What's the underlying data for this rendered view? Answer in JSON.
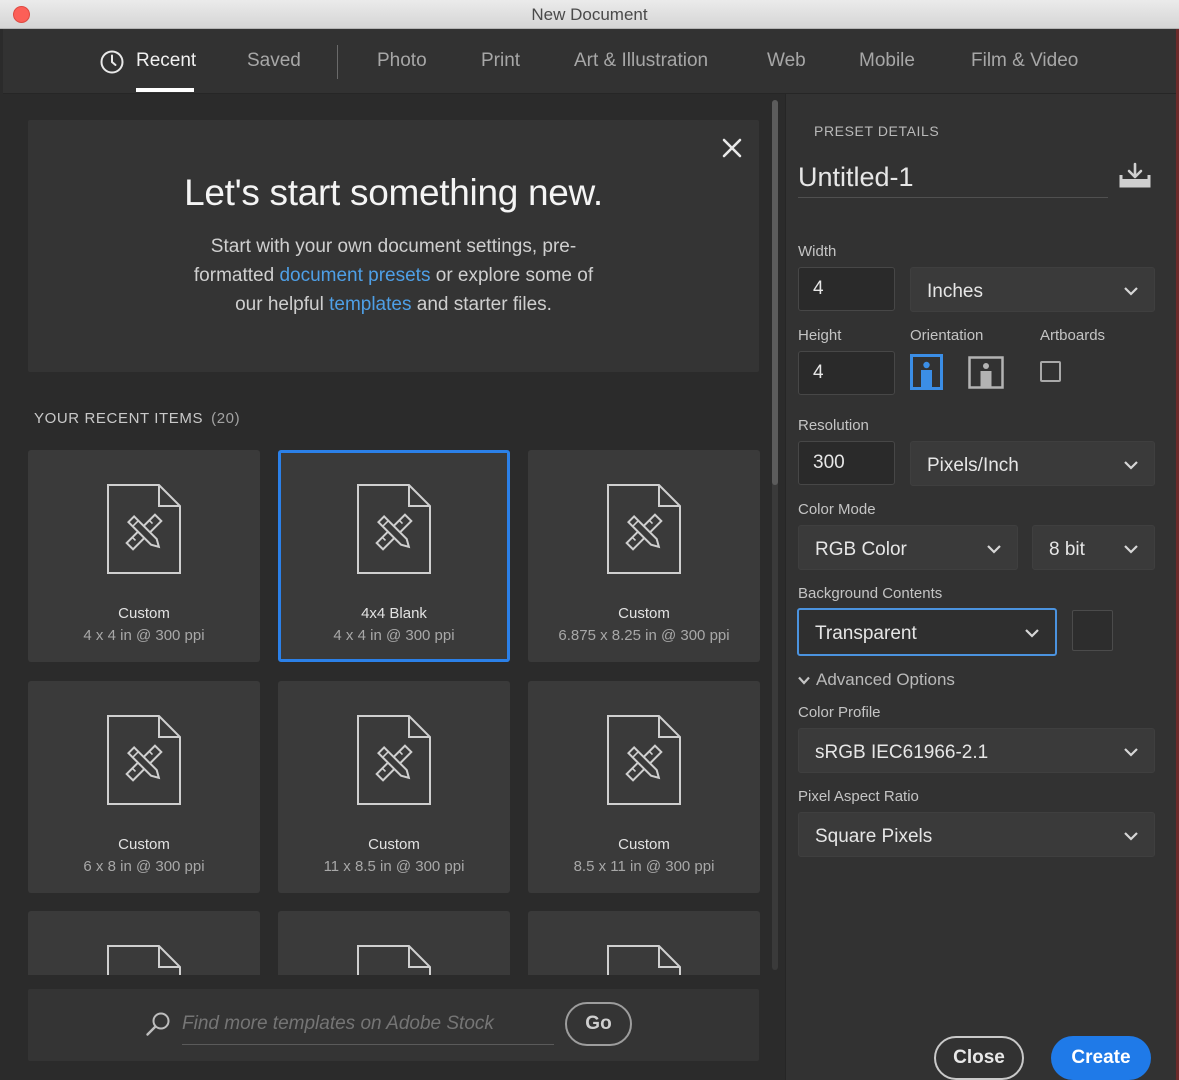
{
  "window": {
    "title": "New Document"
  },
  "tabs": [
    {
      "label": "Recent",
      "active": true
    },
    {
      "label": "Saved"
    },
    {
      "label": "Photo"
    },
    {
      "label": "Print"
    },
    {
      "label": "Art & Illustration"
    },
    {
      "label": "Web"
    },
    {
      "label": "Mobile"
    },
    {
      "label": "Film & Video"
    }
  ],
  "welcome": {
    "heading": "Let's start something new.",
    "line1": "Start with your own document settings, pre-",
    "line2_a": "formatted ",
    "line2_link": "document presets",
    "line2_b": " or explore some of",
    "line3_a": "our helpful ",
    "line3_link": "templates",
    "line3_b": " and starter files."
  },
  "recent": {
    "label": "YOUR RECENT ITEMS",
    "count": "(20)",
    "items": [
      {
        "name": "Custom",
        "size": "4 x 4 in @ 300 ppi"
      },
      {
        "name": "4x4 Blank",
        "size": "4 x 4 in @ 300 ppi",
        "selected": true
      },
      {
        "name": "Custom",
        "size": "6.875 x 8.25 in @ 300 ppi"
      },
      {
        "name": "Custom",
        "size": "6 x 8 in @ 300 ppi"
      },
      {
        "name": "Custom",
        "size": "11 x 8.5 in @ 300 ppi"
      },
      {
        "name": "Custom",
        "size": "8.5 x 11 in @ 300 ppi"
      }
    ]
  },
  "stock": {
    "placeholder": "Find more templates on Adobe Stock",
    "go_label": "Go"
  },
  "preset": {
    "section_title": "PRESET DETAILS",
    "doc_name": "Untitled-1",
    "width_label": "Width",
    "width_value": "4",
    "width_unit": "Inches",
    "height_label": "Height",
    "height_value": "4",
    "orientation_label": "Orientation",
    "orientation_selected": "portrait",
    "artboards_label": "Artboards",
    "artboards_checked": false,
    "resolution_label": "Resolution",
    "resolution_value": "300",
    "resolution_unit": "Pixels/Inch",
    "color_mode_label": "Color Mode",
    "color_mode": "RGB Color",
    "bit_depth": "8 bit",
    "background_label": "Background Contents",
    "background": "Transparent",
    "advanced_label": "Advanced Options",
    "color_profile_label": "Color Profile",
    "color_profile": "sRGB IEC61966-2.1",
    "pixel_aspect_label": "Pixel Aspect Ratio",
    "pixel_aspect": "Square Pixels"
  },
  "actions": {
    "close_label": "Close",
    "create_label": "Create"
  },
  "colors": {
    "accent": "#1f7ae8",
    "link": "#4e9fe6",
    "selected_border": "#2b80e8"
  }
}
